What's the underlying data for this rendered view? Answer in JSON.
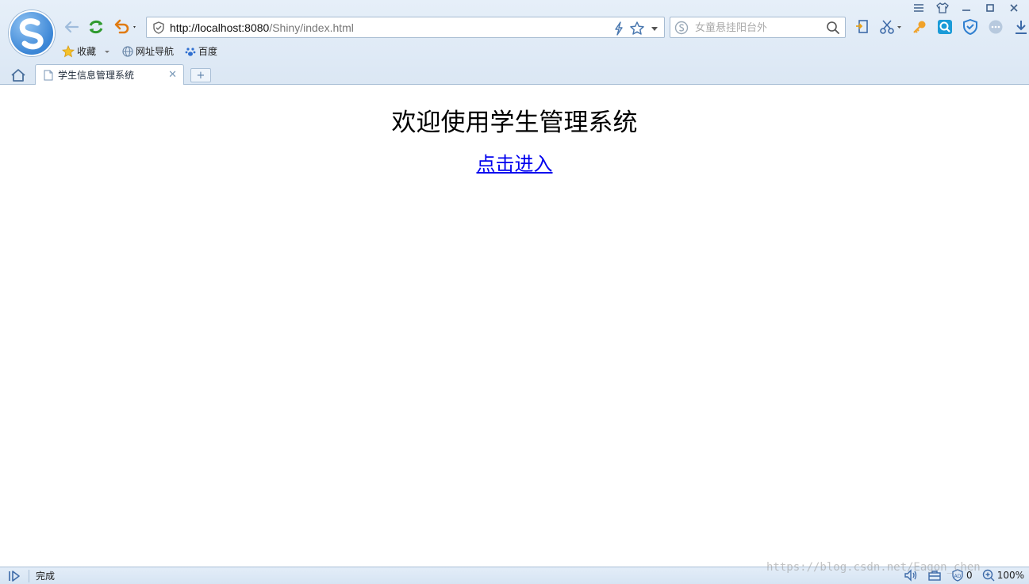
{
  "browser": {
    "address": {
      "scheme_host": "http://localhost:8080",
      "path": "/Shiny/index.html"
    },
    "search": {
      "placeholder": "女童悬挂阳台外"
    },
    "bookmarks": [
      {
        "label": "收藏",
        "icon": "star-icon"
      },
      {
        "label": "网址导航",
        "icon": "globe-icon"
      },
      {
        "label": "百度",
        "icon": "paw-icon"
      }
    ],
    "tabs": [
      {
        "title": "学生信息管理系统"
      }
    ],
    "new_tab_label": "+",
    "accent_color": "#3b86d6"
  },
  "page": {
    "heading": "欢迎使用学生管理系统",
    "enter_link": "点击进入",
    "link_color": "#0000ee"
  },
  "status": {
    "text": "完成",
    "blocked_count": "0",
    "zoom": "100%"
  },
  "watermark": "https://blog.csdn.net/Eagon_chen"
}
